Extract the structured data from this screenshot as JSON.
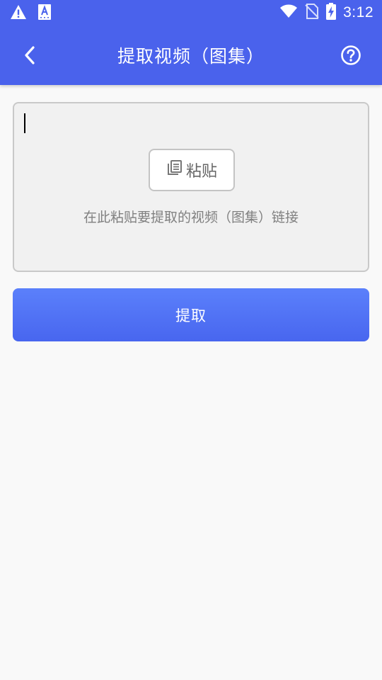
{
  "status_bar": {
    "time": "3:12",
    "icons": [
      "warning-icon",
      "keyboard-a-icon",
      "wifi-icon",
      "no-sim-icon",
      "battery-charging-icon"
    ]
  },
  "toolbar": {
    "title": "提取视频（图集）",
    "back_icon": "chevron-left-icon",
    "help_icon": "help-circle-icon"
  },
  "input": {
    "paste_label": "粘贴",
    "paste_icon": "clipboard-copy-icon",
    "hint": "在此粘贴要提取的视频（图集）链接"
  },
  "extract_label": "提取",
  "colors": {
    "primary": "#4a62ec",
    "button_top": "#5b80fb",
    "button_bottom": "#4866ef",
    "background": "#f9f9f9",
    "card": "#f1f1f1"
  }
}
